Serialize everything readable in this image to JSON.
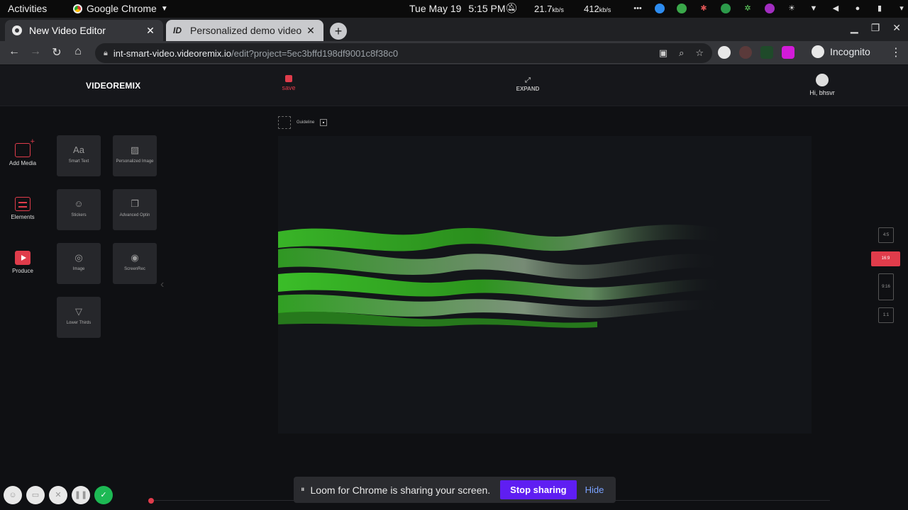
{
  "os_bar": {
    "activities": "Activities",
    "app_name": "Google Chrome",
    "date": "Tue May 19",
    "time": "5:15 PM",
    "net_down": "21.7",
    "net_up": "412",
    "net_unit": "kb/s"
  },
  "browser": {
    "tabs": [
      {
        "label": "New Video Editor",
        "active": true
      },
      {
        "label": "Personalized demo video",
        "active": false
      }
    ],
    "url_host": "int-smart-video.videoremix.io",
    "url_path": "/edit?project=5ec3bffd198df9001c8f38c0",
    "profile": "Incognito"
  },
  "app": {
    "logo": "VIDEOREMIX",
    "save_label": "save",
    "expand_label": "EXPAND",
    "greeting": "Hi, bhsvr",
    "sidebar": [
      {
        "label": "Add Media"
      },
      {
        "label": "Elements"
      },
      {
        "label": "Produce"
      }
    ],
    "tiles": [
      {
        "label": "Smart Text"
      },
      {
        "label": "Personalized Image"
      },
      {
        "label": "Stickers"
      },
      {
        "label": "Advanced Optin"
      },
      {
        "label": "Image"
      },
      {
        "label": "ScreenRec"
      },
      {
        "label": "Lower Thirds"
      }
    ],
    "guideline_label": "Guideline",
    "ratios": [
      "4:5",
      "16:9",
      "9:16",
      "1:1"
    ],
    "active_ratio": "16:9",
    "accent_color": "#e03c4b"
  },
  "loom": {
    "message": "Loom for Chrome is sharing your screen.",
    "stop_label": "Stop sharing",
    "hide_label": "Hide",
    "button_color": "#5f1ef2"
  }
}
